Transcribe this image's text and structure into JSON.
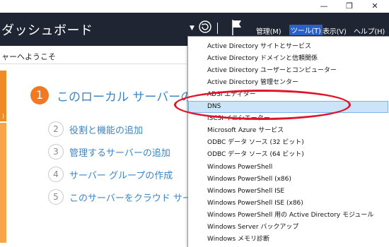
{
  "window": {
    "minimize": "—",
    "restore": "❐",
    "close": "✕"
  },
  "header": {
    "title": "ダッシュボード",
    "menus": {
      "manage": "管理(M)",
      "tools": "ツール(T)",
      "view": "表示(V)",
      "help": "ヘルプ(H)"
    }
  },
  "welcome": {
    "text": "ャーへようこそ"
  },
  "sidebar": {
    "orange_label": ")"
  },
  "steps": [
    {
      "number": "1",
      "label": "このローカル サーバーの構"
    },
    {
      "number": "2",
      "label": "役割と機能の追加"
    },
    {
      "number": "3",
      "label": "管理するサーバーの追加"
    },
    {
      "number": "4",
      "label": "サーバー グループの作成"
    },
    {
      "number": "5",
      "label": "このサーバーをクラウド サービス"
    }
  ],
  "tools_menu": {
    "items": [
      "Active Directory サイトとサービス",
      "Active Directory ドメインと信頼関係",
      "Active Directory ユーザーとコンピューター",
      "Active Directory 管理センター",
      "ADSI エディター",
      "DNS",
      "iSCSI イニシエーター",
      "Microsoft Azure サービス",
      "ODBC データ ソース (32 ビット)",
      "ODBC データ ソース (64 ビット)",
      "Windows PowerShell",
      "Windows PowerShell (x86)",
      "Windows PowerShell ISE",
      "Windows PowerShell ISE (x86)",
      "Windows PowerShell 用の Active Directory モジュール",
      "Windows Server バックアップ",
      "Windows メモリ診断"
    ],
    "selected": "DNS"
  },
  "colors": {
    "header_bg": "#1f2533",
    "accent": "#2b61c6",
    "highlight_ring": "#e0142a",
    "step_orange": "#f07a24"
  }
}
